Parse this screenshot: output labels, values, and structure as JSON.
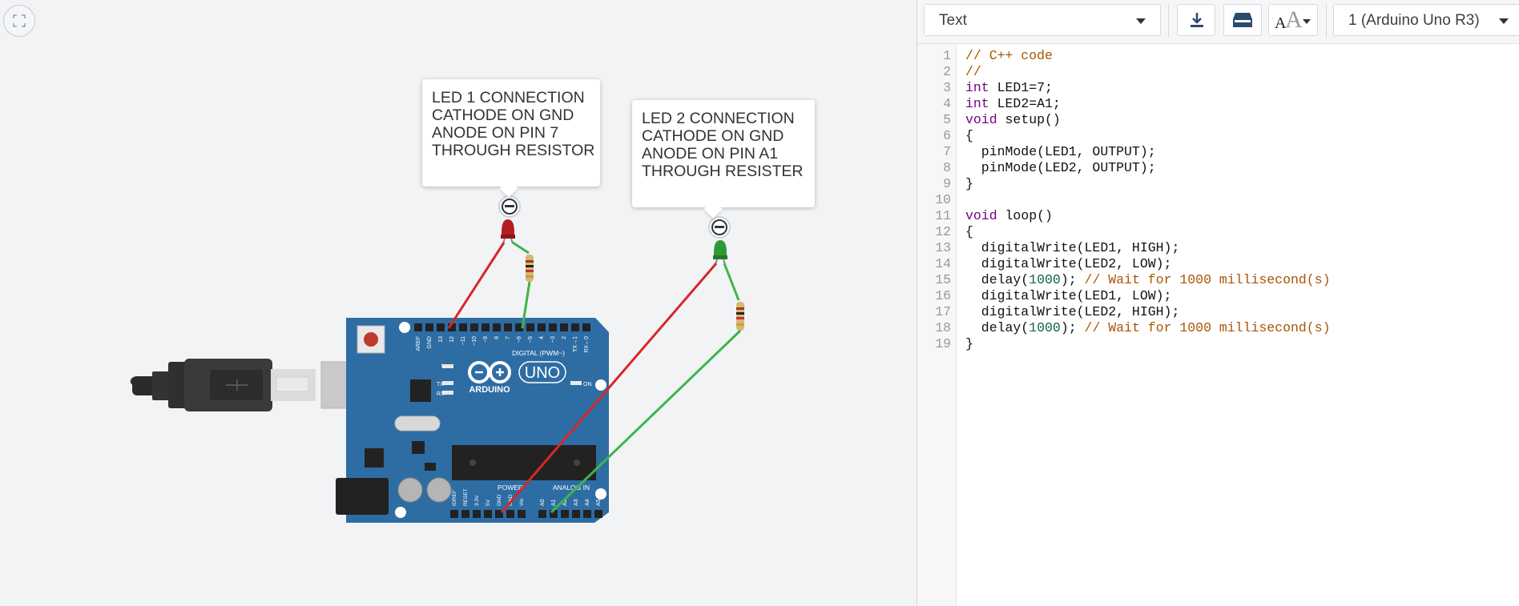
{
  "annotations": {
    "led1_note": "LED 1 CONNECTION\nCATHODE ON GND\nANODE ON PIN 7\nTHROUGH RESISTOR",
    "led2_note": "LED 2 CONNECTION\nCATHODE ON GND\nANODE ON PIN A1\nTHROUGH RESISTER"
  },
  "board": {
    "logo_text": "ARDUINO",
    "model": "UNO",
    "digital_label": "DIGITAL (PWM~)",
    "power_label": "POWER",
    "analog_label": "ANALOG IN",
    "on_label": "ON",
    "tx_label": "TX",
    "rx_label": "RX",
    "l_label": "L",
    "digital_pins": [
      "AREF",
      "GND",
      "13",
      "12",
      "~11",
      "~10",
      "~9",
      "8",
      "7",
      "~6",
      "~5",
      "4",
      "~3",
      "2",
      "TX→1",
      "RX←0"
    ],
    "power_pins": [
      "IOREF",
      "RESET",
      "3.3V",
      "5V",
      "GND",
      "GND",
      "Vin"
    ],
    "analog_pins": [
      "A0",
      "A1",
      "A2",
      "A3",
      "A4",
      "A5"
    ]
  },
  "toolbar": {
    "mode": "Text",
    "board_select": "1 (Arduino Uno R3)",
    "download_icon": "download-icon",
    "upload_icon": "upload-icon",
    "font_icon": "font-size-icon"
  },
  "editor": {
    "line_numbers": [
      "1",
      "2",
      "3",
      "4",
      "5",
      "6",
      "7",
      "8",
      "9",
      "10",
      "11",
      "12",
      "13",
      "14",
      "15",
      "16",
      "17",
      "18",
      "19"
    ]
  },
  "colors": {
    "led1": "#b41e1e",
    "led2": "#2f9a35",
    "wire_red": "#d62828",
    "wire_green": "#3db54a",
    "board": "#2e6da4"
  }
}
